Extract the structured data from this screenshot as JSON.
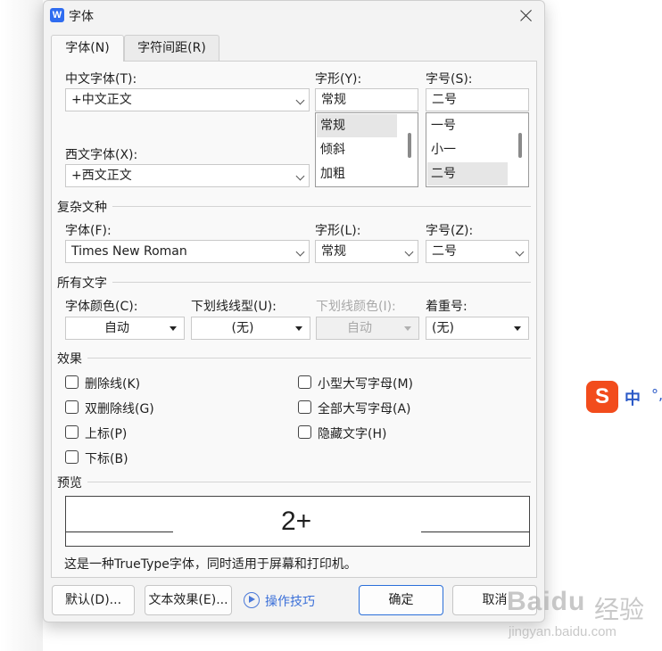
{
  "dialog": {
    "title": "字体",
    "app_icon_letter": "W",
    "tabs": [
      "字体(N)",
      "字符间距(R)"
    ]
  },
  "chinese_font": {
    "label": "中文字体(T):",
    "value": "+中文正文"
  },
  "western_font": {
    "label": "西文字体(X):",
    "value": "+西文正文"
  },
  "style": {
    "label": "字形(Y):",
    "value": "常规",
    "options": [
      "常规",
      "倾斜",
      "加粗"
    ],
    "selected": "常规"
  },
  "size": {
    "label": "字号(S):",
    "value": "二号",
    "options": [
      "一号",
      "小一",
      "二号"
    ],
    "selected": "二号"
  },
  "complex": {
    "section": "复杂文种",
    "font_label": "字体(F):",
    "font_value": "Times New Roman",
    "style_label": "字形(L):",
    "style_value": "常规",
    "size_label": "字号(Z):",
    "size_value": "二号"
  },
  "all_text": {
    "section": "所有文字",
    "color_label": "字体颜色(C):",
    "color_value": "自动",
    "underline_label": "下划线线型(U):",
    "underline_value": "(无)",
    "underline_color_label": "下划线颜色(I):",
    "underline_color_value": "自动",
    "emphasis_label": "着重号:",
    "emphasis_value": "(无)"
  },
  "effects": {
    "section": "效果",
    "left": [
      "删除线(K)",
      "双删除线(G)",
      "上标(P)",
      "下标(B)"
    ],
    "right": [
      "小型大写字母(M)",
      "全部大写字母(A)",
      "隐藏文字(H)"
    ]
  },
  "preview": {
    "section": "预览",
    "sample": "2+",
    "note": "这是一种TrueType字体，同时适用于屏幕和打印机。"
  },
  "buttons": {
    "default": "默认(D)...",
    "text_effects": "文本效果(E)...",
    "tips": "操作技巧",
    "ok": "确定",
    "cancel": "取消"
  },
  "ime": {
    "logo": "S",
    "mode": "中",
    "punct": "°,"
  },
  "watermark": {
    "brand": "Baidu",
    "cn": "经验",
    "url": "jingyan.baidu.com"
  },
  "colors": {
    "accent": "#2a6fd9",
    "link": "#3a6fd8",
    "ime": "#f24c1c"
  }
}
